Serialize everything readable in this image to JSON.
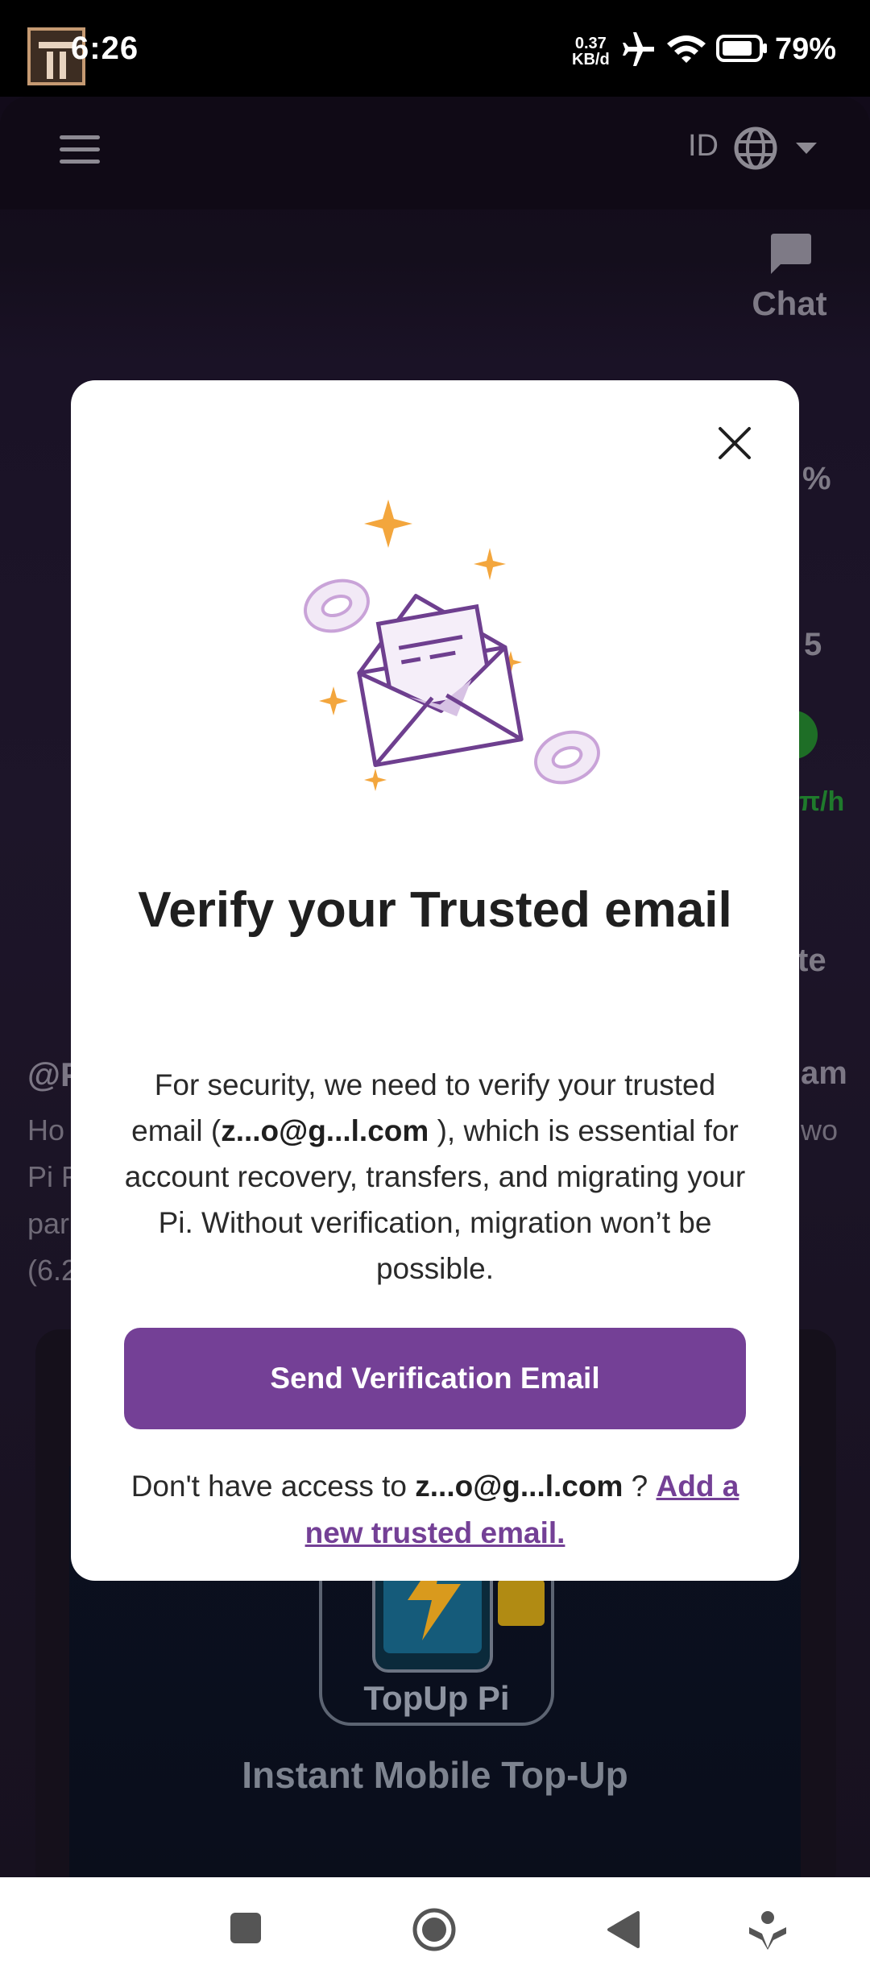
{
  "status_bar": {
    "time": "6:26",
    "speed_value": "0.37",
    "speed_unit": "KB/d",
    "battery": "79%"
  },
  "header": {
    "language": "ID"
  },
  "side": {
    "chat_label": "Chat",
    "frag_percent": "%",
    "frag_count": "5",
    "frag_rate": "π/h",
    "frag_te": "te"
  },
  "background": {
    "left_handle": "@P",
    "left_line1": "Ho",
    "left_line2": "Pi F",
    "left_line3": "par",
    "left_line4": "(6.2",
    "right_line1": "am",
    "right_line2": "wo",
    "promo_name": "TopUp Pi",
    "promo_tagline": "Instant Mobile Top-Up"
  },
  "modal": {
    "title": "Verify your Trusted email",
    "body_before": "For security, we need to verify your trusted email (",
    "masked_email": "z...o@g...l.com",
    "body_after": " ), which is essential for account recovery, transfers, and migrating your Pi. Without verification, migration won’t be possible.",
    "send_button": "Send Verification Email",
    "footer_before": "Don't have access to ",
    "footer_email": "z...o@g...l.com",
    "footer_middle": " ? ",
    "footer_link": "Add a new trusted email."
  },
  "colors": {
    "accent": "#744096",
    "star": "#f3a63d",
    "modal_bg": "#ffffff"
  },
  "icons": {
    "close": "close-icon",
    "menu": "menu-icon",
    "globe": "globe-icon",
    "chat": "chat-icon"
  }
}
